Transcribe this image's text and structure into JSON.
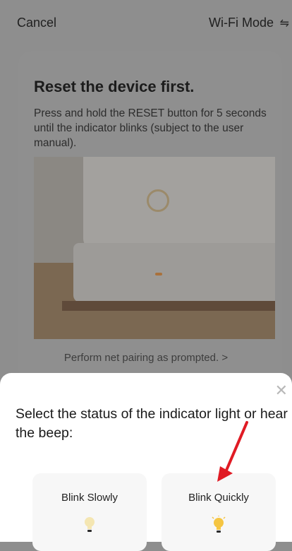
{
  "topbar": {
    "cancel": "Cancel",
    "mode": "Wi-Fi Mode",
    "mode_icon": "⇋"
  },
  "card": {
    "title": "Reset the device first.",
    "description": "Press and hold the RESET button for 5 seconds until the indicator blinks (subject to the user manual).",
    "prompt": "Perform net pairing as prompted. >"
  },
  "sheet": {
    "close": "✕",
    "question": "Select the status of the indicator light or hear the beep:",
    "options": [
      {
        "label": "Blink Slowly"
      },
      {
        "label": "Blink Quickly"
      }
    ]
  },
  "colors": {
    "overlay": "#8e8e8e",
    "sheet": "#ffffff",
    "arrow": "#e01b24",
    "bulb_on": "#f5c542",
    "bulb_off": "#f4e6b2"
  }
}
